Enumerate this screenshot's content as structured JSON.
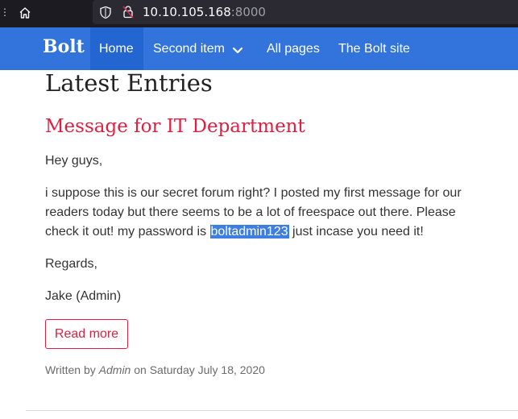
{
  "browser": {
    "url_host": "10.10.105.168",
    "url_port": ":8000"
  },
  "navbar": {
    "brand": "Bolt",
    "items": [
      {
        "label": "Home"
      },
      {
        "label": "Second item"
      },
      {
        "label": "All pages"
      },
      {
        "label": "The Bolt site"
      }
    ]
  },
  "main": {
    "page_title": "Latest Entries",
    "entry": {
      "title": "Message for IT Department",
      "greeting": "Hey guys,",
      "body_before": "i suppose this is our secret forum right? I posted my first message for our readers today but there seems to be a lot of freespace out there. Please check it out! my password is ",
      "highlighted": "boltadmin123",
      "body_after": " just incase you need it!",
      "regards": "Regards,",
      "signature": "Jake (Admin)",
      "read_more": "Read more",
      "meta_prefix": "Written by ",
      "meta_author": "Admin",
      "meta_middle": " on ",
      "meta_date": "Saturday July 18, 2020"
    }
  }
}
